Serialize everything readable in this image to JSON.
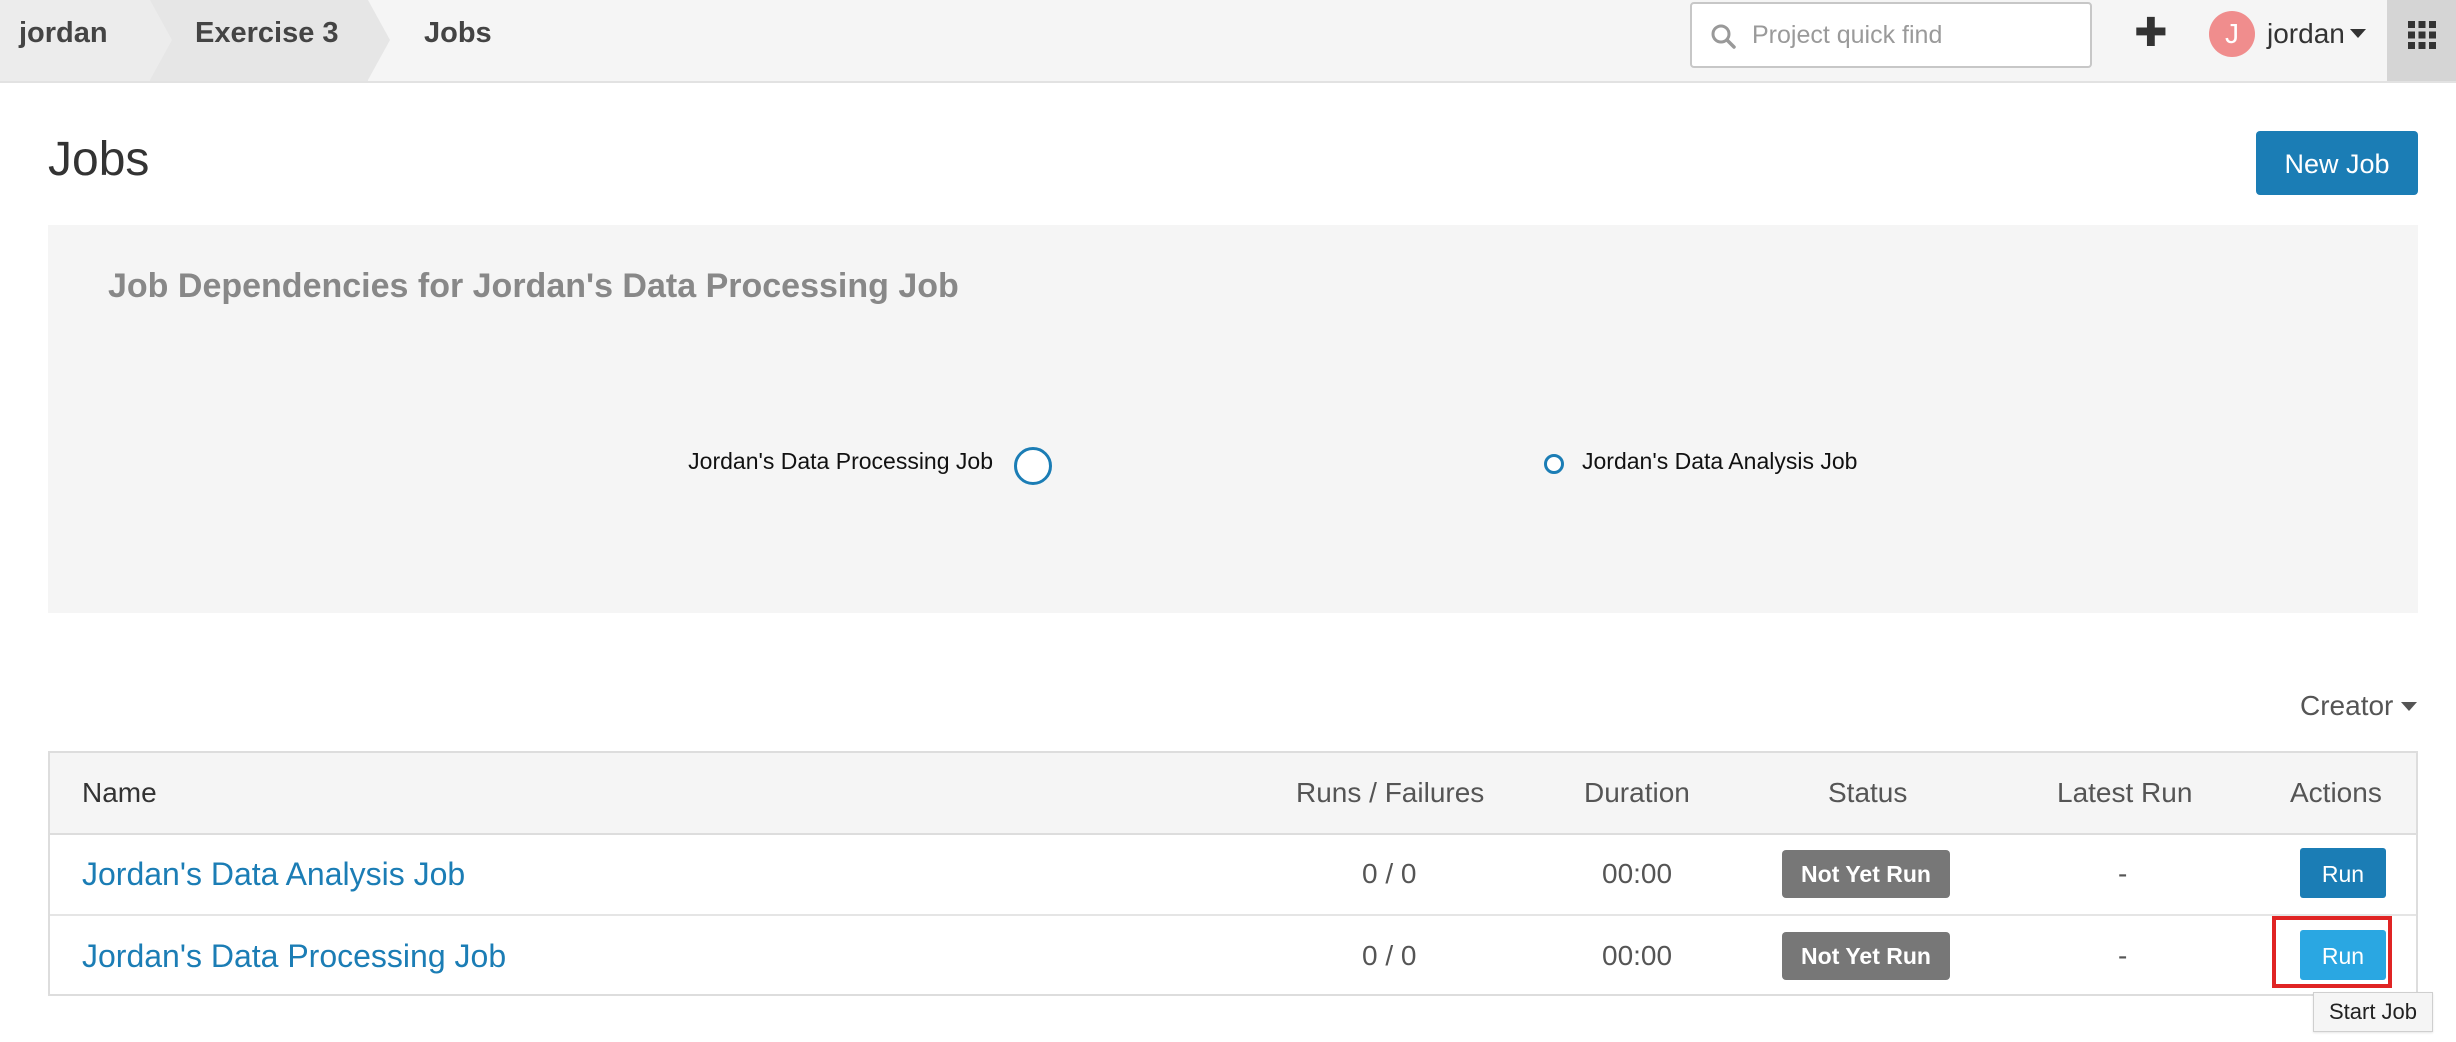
{
  "topbar": {
    "breadcrumb": [
      "jordan",
      "Exercise 3",
      "Jobs"
    ],
    "search_placeholder": "Project quick find",
    "add_label": "✚",
    "avatar_initial": "J",
    "username": "jordan",
    "avatar_color": "#f08d8d"
  },
  "page": {
    "title": "Jobs",
    "new_job_label": "New Job"
  },
  "dependencies": {
    "title": "Job Dependencies for Jordan's Data Processing Job",
    "nodes": [
      "Jordan's Data Processing Job",
      "Jordan's Data Analysis Job"
    ]
  },
  "filter": {
    "creator_label": "Creator"
  },
  "table": {
    "columns": [
      "Name",
      "Runs / Failures",
      "Duration",
      "Status",
      "Latest Run",
      "Actions"
    ],
    "rows": [
      {
        "name": "Jordan's Data Analysis Job",
        "runs": "0 / 0",
        "duration": "00:00",
        "status": "Not Yet Run",
        "latest": "-",
        "action": "Run"
      },
      {
        "name": "Jordan's Data Processing Job",
        "runs": "0 / 0",
        "duration": "00:00",
        "status": "Not Yet Run",
        "latest": "-",
        "action": "Run"
      }
    ]
  },
  "tooltip": {
    "text": "Start Job"
  },
  "colors": {
    "accent": "#1b7db5",
    "run_hover": "#2aa7e2",
    "status_badge": "#777777",
    "highlight": "#e02424"
  }
}
